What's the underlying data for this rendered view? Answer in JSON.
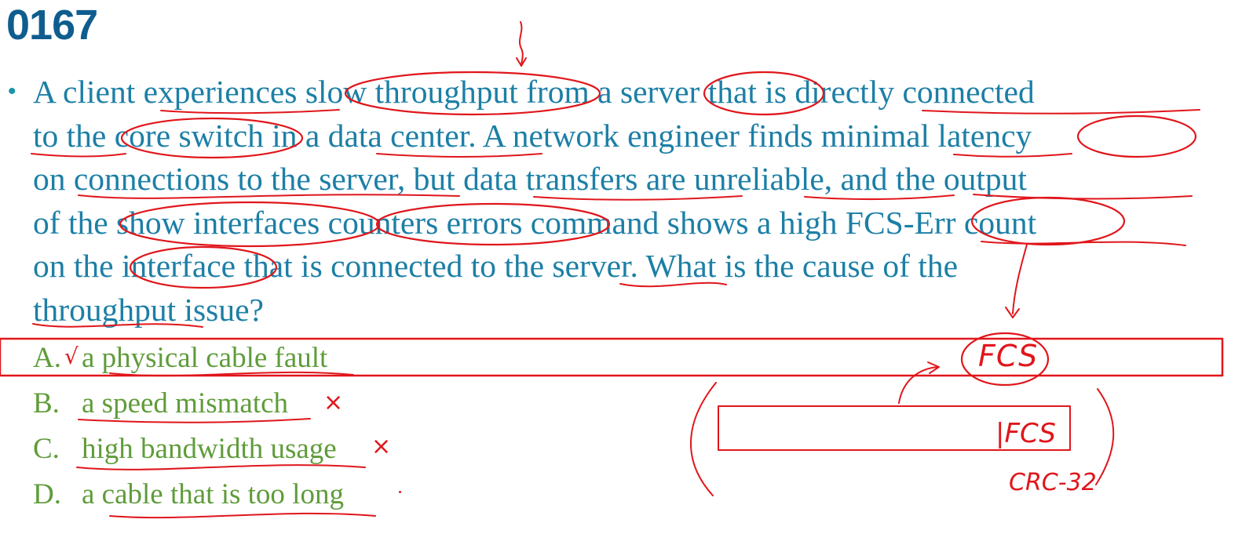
{
  "question_number": "0167",
  "question_lines": [
    "A client experiences slow throughput from a server that is directly connected",
    "to the core switch in a data center. A network engineer finds minimal latency",
    "on connections to the server, but data transfers are unreliable, and the output",
    "of the show interfaces counters errors command shows a high FCS-Err count",
    "on the interface that is connected to the server. What is the cause of the",
    "throughput issue?"
  ],
  "options": [
    {
      "letter": "A.",
      "text": "a physical cable fault",
      "mark": "√"
    },
    {
      "letter": "B.",
      "text": "a speed mismatch",
      "mark": "×"
    },
    {
      "letter": "C.",
      "text": "high bandwidth usage",
      "mark": "×"
    },
    {
      "letter": "D.",
      "text": "a cable that is too long",
      "mark": ""
    }
  ],
  "annotations": {
    "fcs_label": "FCS",
    "frame_fcs_label": "|FCS",
    "crc_label": "CRC-32"
  },
  "colors": {
    "title": "#0f5d8f",
    "question_text": "#1c7fa6",
    "option_text": "#5f9c3a",
    "ink": "#e0161b"
  }
}
